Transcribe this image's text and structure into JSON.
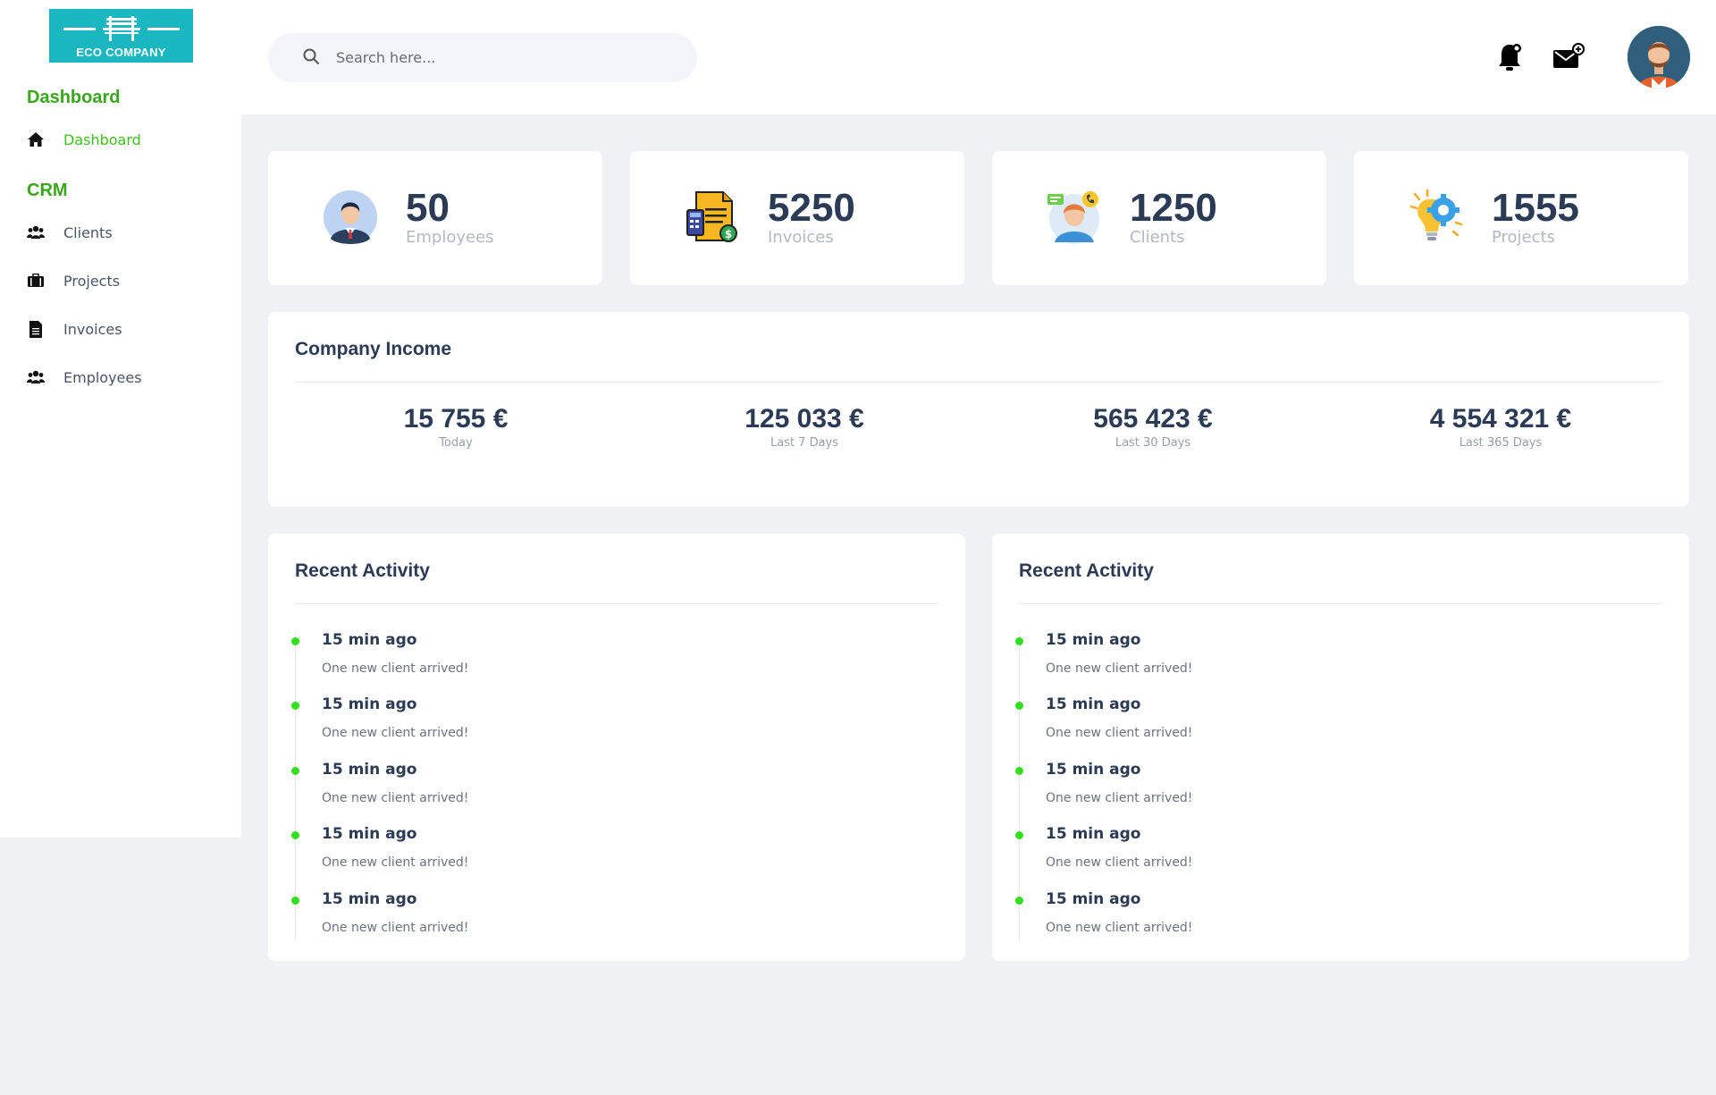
{
  "logo": {
    "text": "ECO COMPANY",
    "color": "#1bb7c1"
  },
  "sidebar": {
    "section_dashboard": "Dashboard",
    "section_crm": "CRM",
    "items": [
      {
        "label": "Dashboard",
        "icon": "home-icon",
        "active": true
      },
      {
        "label": "Clients",
        "icon": "users-icon"
      },
      {
        "label": "Projects",
        "icon": "briefcase-icon"
      },
      {
        "label": "Invoices",
        "icon": "document-icon"
      },
      {
        "label": "Employees",
        "icon": "users-icon"
      }
    ],
    "accent": "#3aa61b"
  },
  "header": {
    "search_placeholder": "Search here...",
    "icons": [
      "search-icon",
      "bell-icon",
      "mail-icon",
      "avatar"
    ]
  },
  "stats": [
    {
      "value": "50",
      "label": "Employees",
      "icon": "employee-avatar-icon"
    },
    {
      "value": "5250",
      "label": "Invoices",
      "icon": "invoice-icon"
    },
    {
      "value": "1250",
      "label": "Clients",
      "icon": "client-support-icon"
    },
    {
      "value": "1555",
      "label": "Projects",
      "icon": "idea-gear-icon"
    }
  ],
  "income": {
    "title": "Company Income",
    "items": [
      {
        "amount": "15 755 €",
        "period": "Today"
      },
      {
        "amount": "125 033 €",
        "period": "Last 7 Days"
      },
      {
        "amount": "565 423 €",
        "period": "Last 30 Days"
      },
      {
        "amount": "4 554 321 €",
        "period": "Last 365 Days"
      }
    ]
  },
  "activity_left": {
    "title": "Recent Activity",
    "items": [
      {
        "time": "15 min ago",
        "text": "One new client arrived!"
      },
      {
        "time": "15 min ago",
        "text": "One new client arrived!"
      },
      {
        "time": "15 min ago",
        "text": "One new client arrived!"
      },
      {
        "time": "15 min ago",
        "text": "One new client arrived!"
      },
      {
        "time": "15 min ago",
        "text": "One new client arrived!"
      }
    ]
  },
  "activity_right": {
    "title": "Recent Activity",
    "items": [
      {
        "time": "15 min ago",
        "text": "One new client arrived!"
      },
      {
        "time": "15 min ago",
        "text": "One new client arrived!"
      },
      {
        "time": "15 min ago",
        "text": "One new client arrived!"
      },
      {
        "time": "15 min ago",
        "text": "One new client arrived!"
      },
      {
        "time": "15 min ago",
        "text": "One new client arrived!"
      }
    ]
  },
  "colors": {
    "dot": "#2fe01b",
    "text": "#2b3a55",
    "background": "#eff1f5"
  }
}
